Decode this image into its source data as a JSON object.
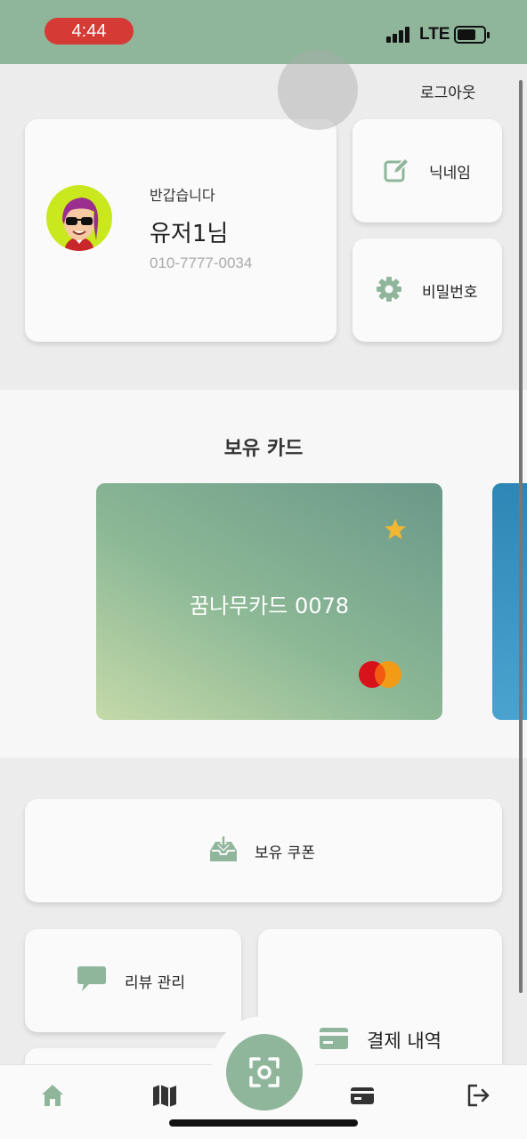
{
  "status_bar": {
    "time": "4:44",
    "network": "LTE"
  },
  "header": {
    "logout_label": "로그아웃"
  },
  "profile": {
    "greeting": "반갑습니다",
    "username": "유저1님",
    "phone": "010-7777-0034"
  },
  "actions": {
    "nickname_label": "닉네임",
    "password_label": "비밀번호"
  },
  "cards_section": {
    "title": "보유 카드",
    "card_name": "꿈나무카드 0078"
  },
  "menu": {
    "coupon_label": "보유 쿠폰",
    "review_label": "리뷰 관리",
    "payment_label": "결제 내역"
  },
  "colors": {
    "accent": "#8fb69b",
    "status_pill": "#d63a34",
    "star": "#f2b632"
  },
  "icons": [
    "edit-icon",
    "gear-icon",
    "star-icon",
    "mastercard-icon",
    "inbox-icon",
    "chat-icon",
    "card-icon",
    "home-icon",
    "map-icon",
    "wallet-icon",
    "logout-icon",
    "scan-icon"
  ]
}
